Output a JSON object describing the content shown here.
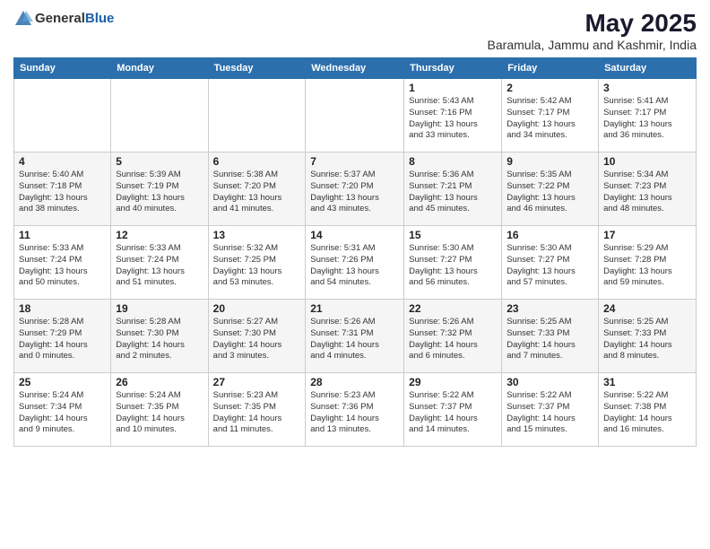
{
  "logo": {
    "general": "General",
    "blue": "Blue"
  },
  "title": "May 2025",
  "subtitle": "Baramula, Jammu and Kashmir, India",
  "days_of_week": [
    "Sunday",
    "Monday",
    "Tuesday",
    "Wednesday",
    "Thursday",
    "Friday",
    "Saturday"
  ],
  "weeks": [
    [
      {
        "day": "",
        "info": ""
      },
      {
        "day": "",
        "info": ""
      },
      {
        "day": "",
        "info": ""
      },
      {
        "day": "",
        "info": ""
      },
      {
        "day": "1",
        "info": "Sunrise: 5:43 AM\nSunset: 7:16 PM\nDaylight: 13 hours\nand 33 minutes."
      },
      {
        "day": "2",
        "info": "Sunrise: 5:42 AM\nSunset: 7:17 PM\nDaylight: 13 hours\nand 34 minutes."
      },
      {
        "day": "3",
        "info": "Sunrise: 5:41 AM\nSunset: 7:17 PM\nDaylight: 13 hours\nand 36 minutes."
      }
    ],
    [
      {
        "day": "4",
        "info": "Sunrise: 5:40 AM\nSunset: 7:18 PM\nDaylight: 13 hours\nand 38 minutes."
      },
      {
        "day": "5",
        "info": "Sunrise: 5:39 AM\nSunset: 7:19 PM\nDaylight: 13 hours\nand 40 minutes."
      },
      {
        "day": "6",
        "info": "Sunrise: 5:38 AM\nSunset: 7:20 PM\nDaylight: 13 hours\nand 41 minutes."
      },
      {
        "day": "7",
        "info": "Sunrise: 5:37 AM\nSunset: 7:20 PM\nDaylight: 13 hours\nand 43 minutes."
      },
      {
        "day": "8",
        "info": "Sunrise: 5:36 AM\nSunset: 7:21 PM\nDaylight: 13 hours\nand 45 minutes."
      },
      {
        "day": "9",
        "info": "Sunrise: 5:35 AM\nSunset: 7:22 PM\nDaylight: 13 hours\nand 46 minutes."
      },
      {
        "day": "10",
        "info": "Sunrise: 5:34 AM\nSunset: 7:23 PM\nDaylight: 13 hours\nand 48 minutes."
      }
    ],
    [
      {
        "day": "11",
        "info": "Sunrise: 5:33 AM\nSunset: 7:24 PM\nDaylight: 13 hours\nand 50 minutes."
      },
      {
        "day": "12",
        "info": "Sunrise: 5:33 AM\nSunset: 7:24 PM\nDaylight: 13 hours\nand 51 minutes."
      },
      {
        "day": "13",
        "info": "Sunrise: 5:32 AM\nSunset: 7:25 PM\nDaylight: 13 hours\nand 53 minutes."
      },
      {
        "day": "14",
        "info": "Sunrise: 5:31 AM\nSunset: 7:26 PM\nDaylight: 13 hours\nand 54 minutes."
      },
      {
        "day": "15",
        "info": "Sunrise: 5:30 AM\nSunset: 7:27 PM\nDaylight: 13 hours\nand 56 minutes."
      },
      {
        "day": "16",
        "info": "Sunrise: 5:30 AM\nSunset: 7:27 PM\nDaylight: 13 hours\nand 57 minutes."
      },
      {
        "day": "17",
        "info": "Sunrise: 5:29 AM\nSunset: 7:28 PM\nDaylight: 13 hours\nand 59 minutes."
      }
    ],
    [
      {
        "day": "18",
        "info": "Sunrise: 5:28 AM\nSunset: 7:29 PM\nDaylight: 14 hours\nand 0 minutes."
      },
      {
        "day": "19",
        "info": "Sunrise: 5:28 AM\nSunset: 7:30 PM\nDaylight: 14 hours\nand 2 minutes."
      },
      {
        "day": "20",
        "info": "Sunrise: 5:27 AM\nSunset: 7:30 PM\nDaylight: 14 hours\nand 3 minutes."
      },
      {
        "day": "21",
        "info": "Sunrise: 5:26 AM\nSunset: 7:31 PM\nDaylight: 14 hours\nand 4 minutes."
      },
      {
        "day": "22",
        "info": "Sunrise: 5:26 AM\nSunset: 7:32 PM\nDaylight: 14 hours\nand 6 minutes."
      },
      {
        "day": "23",
        "info": "Sunrise: 5:25 AM\nSunset: 7:33 PM\nDaylight: 14 hours\nand 7 minutes."
      },
      {
        "day": "24",
        "info": "Sunrise: 5:25 AM\nSunset: 7:33 PM\nDaylight: 14 hours\nand 8 minutes."
      }
    ],
    [
      {
        "day": "25",
        "info": "Sunrise: 5:24 AM\nSunset: 7:34 PM\nDaylight: 14 hours\nand 9 minutes."
      },
      {
        "day": "26",
        "info": "Sunrise: 5:24 AM\nSunset: 7:35 PM\nDaylight: 14 hours\nand 10 minutes."
      },
      {
        "day": "27",
        "info": "Sunrise: 5:23 AM\nSunset: 7:35 PM\nDaylight: 14 hours\nand 11 minutes."
      },
      {
        "day": "28",
        "info": "Sunrise: 5:23 AM\nSunset: 7:36 PM\nDaylight: 14 hours\nand 13 minutes."
      },
      {
        "day": "29",
        "info": "Sunrise: 5:22 AM\nSunset: 7:37 PM\nDaylight: 14 hours\nand 14 minutes."
      },
      {
        "day": "30",
        "info": "Sunrise: 5:22 AM\nSunset: 7:37 PM\nDaylight: 14 hours\nand 15 minutes."
      },
      {
        "day": "31",
        "info": "Sunrise: 5:22 AM\nSunset: 7:38 PM\nDaylight: 14 hours\nand 16 minutes."
      }
    ]
  ]
}
